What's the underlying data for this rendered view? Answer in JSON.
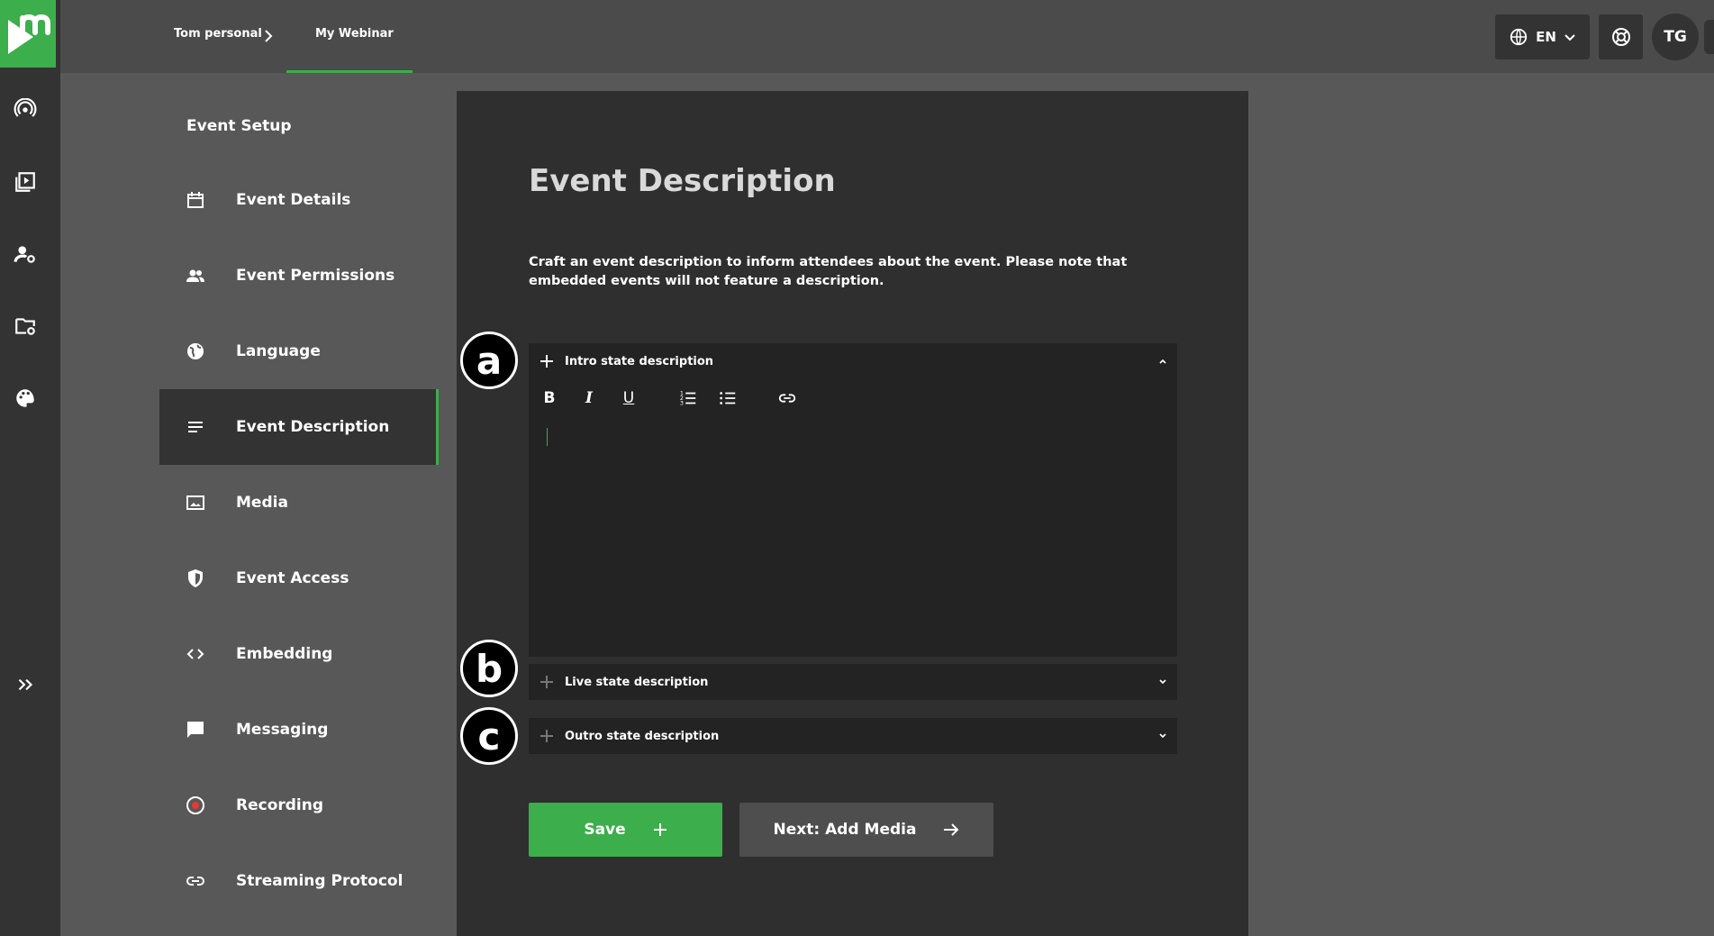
{
  "colors": {
    "accent": "#3cae4b",
    "rail": "#333333",
    "panel": "#2f2f2f",
    "background": "#585858"
  },
  "header": {
    "breadcrumb": {
      "org": "Tom personal",
      "event": "My Webinar"
    },
    "language": "EN",
    "avatar_initials": "TG",
    "icons": [
      "globe-icon",
      "chevron-down-icon",
      "lifebuoy-icon"
    ]
  },
  "rail": {
    "items": [
      "broadcast-icon",
      "video-library-icon",
      "user-settings-icon",
      "folder-settings-icon",
      "palette-icon",
      "expand-icon"
    ]
  },
  "nav": {
    "title": "Event Setup",
    "items": [
      {
        "label": "Event Details",
        "icon": "calendar-icon"
      },
      {
        "label": "Event Permissions",
        "icon": "people-icon"
      },
      {
        "label": "Language",
        "icon": "globe-icon"
      },
      {
        "label": "Event Description",
        "icon": "lines-icon",
        "active": true
      },
      {
        "label": "Media",
        "icon": "image-icon"
      },
      {
        "label": "Event Access",
        "icon": "shield-icon"
      },
      {
        "label": "Embedding",
        "icon": "code-icon"
      },
      {
        "label": "Messaging",
        "icon": "chat-icon"
      },
      {
        "label": "Recording",
        "icon": "record-icon"
      },
      {
        "label": "Streaming Protocol",
        "icon": "link-icon"
      }
    ]
  },
  "main": {
    "title": "Event Description",
    "description": "Craft an event description to inform attendees about the event. Please note that embedded events will not feature a description.",
    "sections": [
      {
        "label": "Intro state description",
        "expanded": true,
        "badge": "a"
      },
      {
        "label": "Live state description",
        "expanded": false,
        "badge": "b"
      },
      {
        "label": "Outro state description",
        "expanded": false,
        "badge": "c"
      }
    ],
    "toolbar": {
      "bold": "B",
      "italic": "I",
      "underline": "U"
    },
    "save_label": "Save",
    "next_label": "Next: Add Media"
  }
}
